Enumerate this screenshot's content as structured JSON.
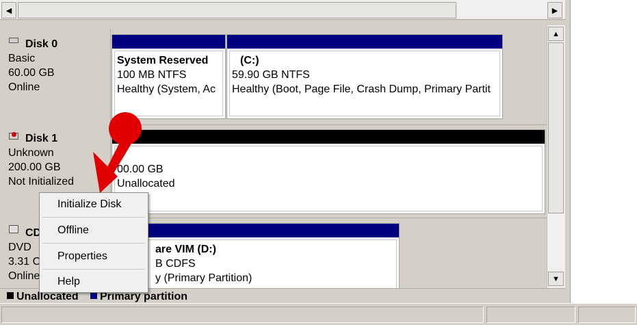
{
  "disks": [
    {
      "name": "Disk 0",
      "type": "Basic",
      "size": "60.00 GB",
      "status": "Online",
      "partitions": [
        {
          "name": "System Reserved",
          "size_fs": "100 MB NTFS",
          "status": "Healthy (System, Ac"
        },
        {
          "name": "(C:)",
          "size_fs": "59.90 GB NTFS",
          "status": "Healthy (Boot, Page File, Crash Dump, Primary Partit"
        }
      ]
    },
    {
      "name": "Disk 1",
      "type": "Unknown",
      "size": "200.00 GB",
      "status": "Not Initialized",
      "partitions": [
        {
          "size": "00.00 GB",
          "status": "Unallocated"
        }
      ]
    },
    {
      "name": "CD",
      "type": "DVD",
      "size": "3.31 C",
      "status": "Online",
      "partitions": [
        {
          "name": "are VIM  (D:)",
          "size_fs": "B CDFS",
          "status": "y (Primary Partition)"
        }
      ]
    }
  ],
  "context_menu": {
    "items": [
      "Initialize Disk",
      "Offline",
      "Properties",
      "Help"
    ]
  },
  "legend": {
    "items": [
      {
        "label": "Unallocated",
        "color": "#000000"
      },
      {
        "label": "Primary partition",
        "color": "#000080"
      }
    ]
  },
  "colors": {
    "primary_partition": "#000080",
    "unallocated": "#000000",
    "annotation_arrow": "#e00000"
  },
  "icons": {
    "disk": "disk-icon",
    "unknown_disk": "disk-error-icon",
    "cdrom": "cdrom-icon"
  }
}
